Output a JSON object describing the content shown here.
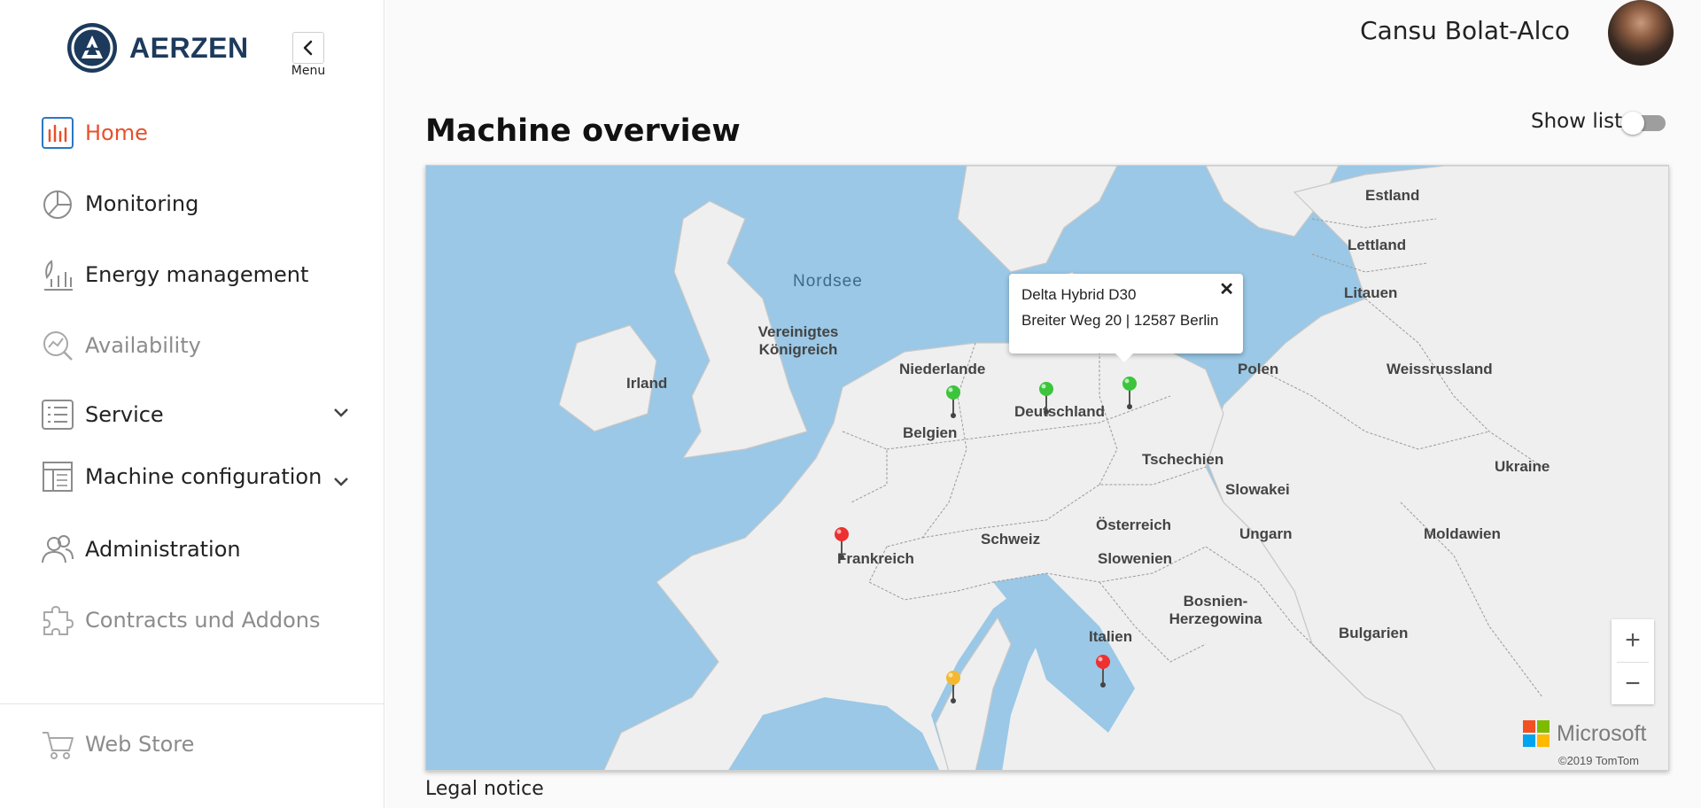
{
  "brand": {
    "name": "AERZEN",
    "color": "#1d3a5c"
  },
  "menu_toggle": {
    "label": "Menu"
  },
  "nav": {
    "items": [
      {
        "label": "Home",
        "icon": "bar-chart-icon",
        "state": "active"
      },
      {
        "label": "Monitoring",
        "icon": "pie-chart-icon",
        "state": "normal"
      },
      {
        "label": "Energy management",
        "icon": "leaf-chart-icon",
        "state": "normal"
      },
      {
        "label": "Availability",
        "icon": "search-chart-icon",
        "state": "disabled"
      },
      {
        "label": "Service",
        "icon": "list-icon",
        "state": "normal",
        "expandable": true
      },
      {
        "label": "Machine configuration",
        "icon": "layout-icon",
        "state": "normal",
        "expandable": true
      },
      {
        "label": "Administration",
        "icon": "users-icon",
        "state": "normal"
      },
      {
        "label": "Contracts und Addons",
        "icon": "puzzle-icon",
        "state": "disabled"
      }
    ],
    "footer": {
      "label": "Web Store",
      "icon": "cart-icon",
      "state": "disabled"
    }
  },
  "colors": {
    "accent": "#e8502a",
    "disabled": "#8c8c8c",
    "water": "#9ac8e6",
    "land": "#efefef"
  },
  "header": {
    "user_name": "Cansu Bolat-Alco"
  },
  "main": {
    "title": "Machine overview",
    "show_list_label": "Show list",
    "show_list_on": false
  },
  "map": {
    "seas": [
      "Nordsee"
    ],
    "countries": [
      "Estland",
      "Lettland",
      "Litauen",
      "Vereinigtes Königreich",
      "Irland",
      "Niederlande",
      "Polen",
      "Weissrussland",
      "Deutschland",
      "Belgien",
      "Tschechien",
      "Ukraine",
      "Slowakei",
      "Österreich",
      "Schweiz",
      "Ungarn",
      "Moldawien",
      "Frankreich",
      "Slowenien",
      "Bosnien-Herzegowina",
      "Italien",
      "Bulgarien"
    ],
    "pins": [
      {
        "status": "green",
        "color": "#3cc43c"
      },
      {
        "status": "green",
        "color": "#3cc43c"
      },
      {
        "status": "green",
        "color": "#3cc43c"
      },
      {
        "status": "red",
        "color": "#ee3030"
      },
      {
        "status": "red",
        "color": "#ee3030"
      },
      {
        "status": "yellow",
        "color": "#f4b830"
      }
    ],
    "popup": {
      "machine": "Delta Hybrid D30",
      "address": "Breiter Weg 20 | 12587 Berlin",
      "close": "✕"
    },
    "zoom_in": "+",
    "zoom_out": "−",
    "provider": "Microsoft",
    "copyright": "©2019 TomTom"
  },
  "footer": {
    "legal": "Legal notice"
  }
}
